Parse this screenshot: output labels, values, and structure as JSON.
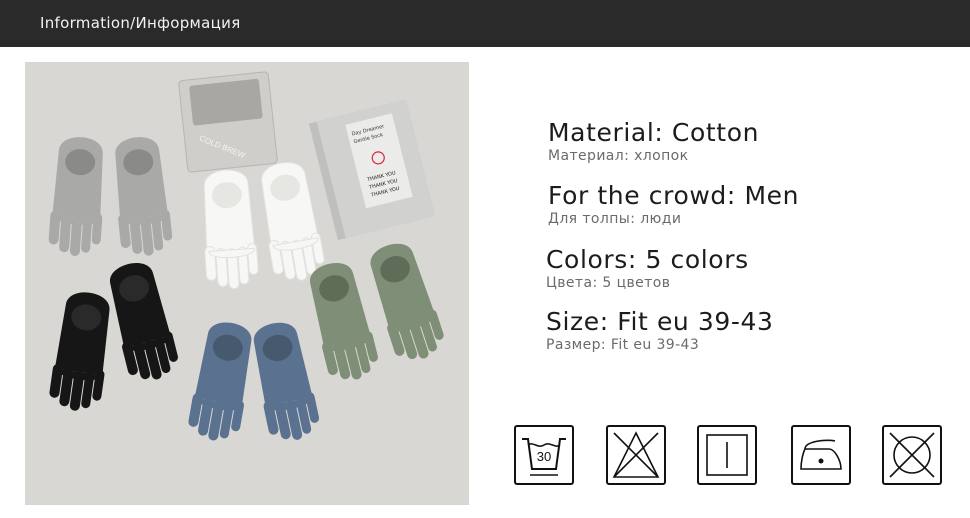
{
  "header": {
    "title": "Information/Информация"
  },
  "photo": {
    "alt": "Five pairs of toe socks",
    "box_brand": "COLD BREW",
    "card_lines": [
      "Day Dreamer",
      "Gentle Sock",
      "THANK YOU",
      "THANK YOU",
      "THANK YOU"
    ]
  },
  "specs": [
    {
      "main": "Material: Cotton",
      "sub": "Материал: хлопок"
    },
    {
      "main": "For the crowd: Men",
      "sub": "Для толпы: люди"
    },
    {
      "main": "Colors: 5 colors",
      "sub": "Цвета: 5 цветов"
    },
    {
      "main": "Size: Fit eu 39-43",
      "sub": "Размер: Fit eu 39-43"
    }
  ],
  "care_icons": [
    {
      "name": "wash-30-icon",
      "label": "30"
    },
    {
      "name": "do-not-bleach-icon"
    },
    {
      "name": "tumble-dry-icon"
    },
    {
      "name": "iron-low-icon"
    },
    {
      "name": "do-not-tumble-dry-icon"
    }
  ],
  "colors": {
    "header_bg": "#2a2a2a",
    "sock_grey": "#a9a9a7",
    "sock_white": "#f7f7f5",
    "sock_black": "#161616",
    "sock_blue": "#5a7290",
    "sock_green": "#7f8e76"
  }
}
